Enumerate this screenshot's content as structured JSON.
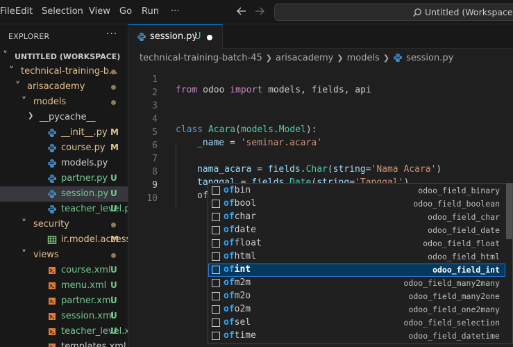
{
  "menu": {
    "items": [
      "File",
      "Edit",
      "Selection",
      "View",
      "Go",
      "Run",
      "···"
    ],
    "back_icon": "arrow-left-icon",
    "forward_icon": "arrow-right-icon"
  },
  "command_center": {
    "text": "Untitled (Workspace)",
    "icon": "search-icon"
  },
  "sidebar": {
    "title": "EXPLORER",
    "more": "···",
    "tree": [
      {
        "label": "UNTITLED (WORKSPACE)",
        "chevron": "v",
        "type": "workspace",
        "badge": ""
      },
      {
        "label": "technical-training-b...",
        "chevron": "v",
        "type": "folder",
        "badge": "dot"
      },
      {
        "label": "arisacademy",
        "chevron": "v",
        "type": "folder",
        "badge": "dot"
      },
      {
        "label": "models",
        "chevron": "v",
        "type": "folder",
        "badge": "dot"
      },
      {
        "label": "__pycache__",
        "chevron": ">",
        "type": "folder",
        "badge": ""
      },
      {
        "label": "__init__.py",
        "type": "python",
        "badge": "M"
      },
      {
        "label": "course.py",
        "type": "python",
        "badge": "M"
      },
      {
        "label": "models.py",
        "type": "python",
        "badge": ""
      },
      {
        "label": "partner.py",
        "type": "python",
        "badge": "U"
      },
      {
        "label": "session.py",
        "type": "python",
        "badge": "U",
        "selected": true
      },
      {
        "label": "teacher_level.py",
        "type": "python",
        "badge": "U"
      },
      {
        "label": "security",
        "chevron": "v",
        "type": "folder",
        "badge": "dot"
      },
      {
        "label": "ir.model.access....",
        "type": "csv",
        "badge": "M"
      },
      {
        "label": "views",
        "chevron": "v",
        "type": "folder",
        "badge": "dot"
      },
      {
        "label": "course.xml",
        "type": "xml",
        "badge": "U"
      },
      {
        "label": "menu.xml",
        "type": "xml",
        "badge": "U"
      },
      {
        "label": "partner.xml",
        "type": "xml",
        "badge": "U"
      },
      {
        "label": "session.xml",
        "type": "xml",
        "badge": "U"
      },
      {
        "label": "teacher_level.xml",
        "type": "xml",
        "badge": "U"
      },
      {
        "label": "templates.xml",
        "type": "xml",
        "badge": ""
      }
    ]
  },
  "tab": {
    "label": "session.py",
    "status": "U"
  },
  "breadcrumb": [
    "technical-training-batch-45",
    "arisacademy",
    "models",
    "session.py"
  ],
  "editor": {
    "line_numbers": [
      "1",
      "2",
      "3",
      "4",
      "5",
      "6",
      "7",
      "8",
      "9",
      "10"
    ],
    "line1": {
      "from": "from",
      "mod": " odoo ",
      "imp": "import",
      "rest": " models, fields, api"
    },
    "line4": {
      "kw": "class",
      "name": "Acara",
      "p1": "(",
      "base1": "models",
      "dot": ".",
      "base2": "Model",
      "p2": "):"
    },
    "line5": {
      "var": "_name",
      "eq": " = ",
      "str": "'seminar.acara'"
    },
    "line7": {
      "var": "nama_acara",
      "eq": " = ",
      "obj": "fields",
      "dot": ".",
      "fn": "Char",
      "p1": "(",
      "kwarg": "string",
      "eq2": "=",
      "str": "'Nama Acara'",
      "p2": ")"
    },
    "line8": {
      "var": "tanggal",
      "eq": " = ",
      "obj": "fields",
      "dot": ".",
      "fn": "Date",
      "p1": "(",
      "kwarg": "string",
      "eq2": "=",
      "str": "'Tanggal'",
      "p2": ")"
    },
    "line9": {
      "text": "of"
    }
  },
  "suggest": {
    "items": [
      {
        "hl": "of",
        "rest": "bin",
        "detail": "odoo_field_binary"
      },
      {
        "hl": "of",
        "rest": "bool",
        "detail": "odoo_field_boolean"
      },
      {
        "hl": "of",
        "rest": "char",
        "detail": "odoo_field_char"
      },
      {
        "hl": "of",
        "rest": "date",
        "detail": "odoo_field_date"
      },
      {
        "hl": "of",
        "rest": "float",
        "detail": "odoo_field_float"
      },
      {
        "hl": "of",
        "rest": "html",
        "detail": "odoo_field_html"
      },
      {
        "hl": "of",
        "rest": "int",
        "detail": "odoo_field_int",
        "focused": true
      },
      {
        "hl": "of",
        "rest": "m2m",
        "detail": "odoo_field_many2many"
      },
      {
        "hl": "of",
        "rest": "m2o",
        "detail": "odoo_field_many2one"
      },
      {
        "hl": "of",
        "rest": "o2m",
        "detail": "odoo_field_one2many"
      },
      {
        "hl": "of",
        "rest": "sel",
        "detail": "odoo_field_selection"
      },
      {
        "hl": "of",
        "rest": "time",
        "detail": "odoo_field_datetime"
      }
    ]
  },
  "colors": {
    "accent": "#0078d4",
    "modified": "#e2c08d",
    "untracked": "#73c991",
    "match": "#2aaaff"
  }
}
